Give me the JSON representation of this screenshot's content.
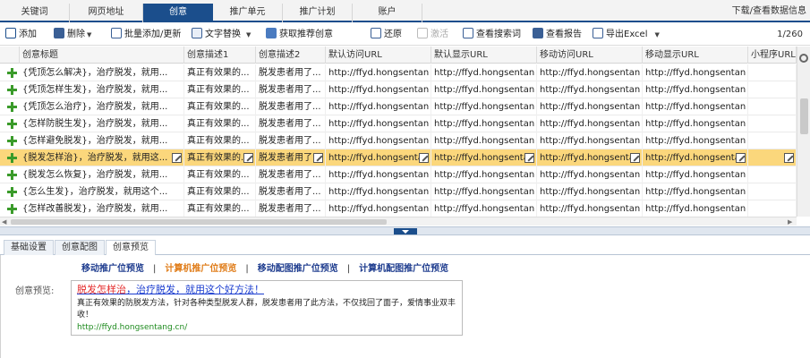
{
  "top_tabs": [
    "关键词",
    "网页地址",
    "创意",
    "推广单元",
    "推广计划",
    "账户"
  ],
  "top_right": "下载/查看数据信息",
  "toolbar": {
    "add": "添加",
    "delete": "删除",
    "batch": "批量添加/更新",
    "replace": "文字替换",
    "recommend": "获取推荐创意",
    "restore": "还原",
    "activate": "激活",
    "search_terms": "查看搜索词",
    "report": "查看报告",
    "export": "导出Excel",
    "count": "1/260"
  },
  "columns": [
    "创意标题",
    "创意描述1",
    "创意描述2",
    "默认访问URL",
    "默认显示URL",
    "移动访问URL",
    "移动显示URL",
    "小程序URL"
  ],
  "rows": [
    {
      "title": "{凭顶怎么解决}，治疗脱发，就用...",
      "d1": "真正有效果的...",
      "d2": "脱发患者用了...",
      "u1": "http://ffyd.hongsentan",
      "u2": "http://ffyd.hongsentan",
      "u3": "http://ffyd.hongsentan",
      "u4": "http://ffyd.hongsentan",
      "u5": ""
    },
    {
      "title": "{凭顶怎样生发}，治疗脱发，就用...",
      "d1": "真正有效果的...",
      "d2": "脱发患者用了...",
      "u1": "http://ffyd.hongsentan",
      "u2": "http://ffyd.hongsentan",
      "u3": "http://ffyd.hongsentan",
      "u4": "http://ffyd.hongsentan",
      "u5": ""
    },
    {
      "title": "{凭顶怎么治疗}，治疗脱发，就用...",
      "d1": "真正有效果的...",
      "d2": "脱发患者用了...",
      "u1": "http://ffyd.hongsentan",
      "u2": "http://ffyd.hongsentan",
      "u3": "http://ffyd.hongsentan",
      "u4": "http://ffyd.hongsentan",
      "u5": ""
    },
    {
      "title": "{怎样防脱生发}，治疗脱发，就用...",
      "d1": "真正有效果的...",
      "d2": "脱发患者用了...",
      "u1": "http://ffyd.hongsentan",
      "u2": "http://ffyd.hongsentan",
      "u3": "http://ffyd.hongsentan",
      "u4": "http://ffyd.hongsentan",
      "u5": ""
    },
    {
      "title": "{怎样避免脱发}，治疗脱发，就用...",
      "d1": "真正有效果的...",
      "d2": "脱发患者用了...",
      "u1": "http://ffyd.hongsentan",
      "u2": "http://ffyd.hongsentan",
      "u3": "http://ffyd.hongsentan",
      "u4": "http://ffyd.hongsentan",
      "u5": ""
    },
    {
      "title": "{脱发怎样治}，治疗脱发，就用这...",
      "d1": "真正有效果的...",
      "d2": "脱发患者用了...",
      "u1": "http://ffyd.hongsentan",
      "u2": "http://ffyd.hongsentan",
      "u3": "http://ffyd.hongsentan",
      "u4": "http://ffyd.hongsentan",
      "u5": ""
    },
    {
      "title": "{脱发怎么恢复}，治疗脱发，就用...",
      "d1": "真正有效果的...",
      "d2": "脱发患者用了...",
      "u1": "http://ffyd.hongsentan",
      "u2": "http://ffyd.hongsentan",
      "u3": "http://ffyd.hongsentan",
      "u4": "http://ffyd.hongsentan",
      "u5": ""
    },
    {
      "title": "{怎么生发}，治疗脱发，就用这个...",
      "d1": "真正有效果的...",
      "d2": "脱发患者用了...",
      "u1": "http://ffyd.hongsentan",
      "u2": "http://ffyd.hongsentan",
      "u3": "http://ffyd.hongsentan",
      "u4": "http://ffyd.hongsentan",
      "u5": ""
    },
    {
      "title": "{怎样改善脱发}，治疗脱发，就用...",
      "d1": "真正有效果的...",
      "d2": "脱发患者用了...",
      "u1": "http://ffyd.hongsentan",
      "u2": "http://ffyd.hongsentan",
      "u3": "http://ffyd.hongsentan",
      "u4": "http://ffyd.hongsentan",
      "u5": ""
    },
    {
      "title": "{怎样减少脱发}，治疗脱发，就用...",
      "d1": "真正有效果的...",
      "d2": "脱发患者用了...",
      "u1": "http://ffyd.hongsentan",
      "u2": "http://ffyd.hongsentan",
      "u3": "http://ffyd.hongsentan",
      "u4": "http://ffyd.hongsentan",
      "u5": ""
    }
  ],
  "selected_row": 5,
  "bottom_tabs": [
    "基础设置",
    "创意配图",
    "创意预览"
  ],
  "preview": {
    "links": [
      "移动推广位预览",
      "计算机推广位预览",
      "移动配图推广位预览",
      "计算机配图推广位预览"
    ],
    "active_link": 1,
    "label": "创意预览:",
    "title_highlight": "脱发怎样治",
    "title_rest": "，治疗脱发，就用这个好方法！",
    "desc": "真正有效果的防脱发方法，针对各种类型脱发人群，脱发患者用了此方法，不仅找回了面子，爱情事业双丰收！",
    "url": "http://ffyd.hongsentang.cn/"
  },
  "colors": {
    "accent": "#1b4e8c",
    "selected_row": "#fbd77c",
    "plus": "#3a9b2a",
    "link_active": "#e07d1a"
  }
}
